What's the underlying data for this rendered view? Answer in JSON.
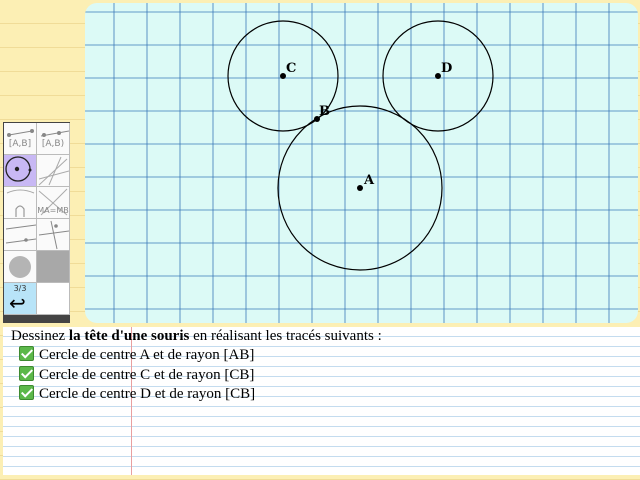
{
  "canvas": {
    "points": [
      {
        "name": "A",
        "label": "A"
      },
      {
        "name": "B",
        "label": "B"
      },
      {
        "name": "C",
        "label": "C"
      },
      {
        "name": "D",
        "label": "D"
      }
    ]
  },
  "toolbar": {
    "segment_label": "[A,B]",
    "ray_label": "[A,B)",
    "equidistant_label": "MA=MB",
    "history_count": "3/3",
    "undo_icon": "undo-arrow-icon"
  },
  "instructions": {
    "intro_before": "Dessinez ",
    "intro_bold": "la tête d'une souris",
    "intro_after": " en réalisant les tracés suivants :",
    "tasks": [
      {
        "text": "Cercle de centre A et de rayon [AB]",
        "done": true
      },
      {
        "text": "Cercle de centre C et de rayon [CB]",
        "done": true
      },
      {
        "text": "Cercle de centre D et de rayon [CB]",
        "done": true
      }
    ]
  },
  "colors": {
    "canvas_bg": "#dcfaf6",
    "grid": "#3a78b8",
    "check": "#5cb84a",
    "selected_tool": "#c8b8f4"
  }
}
